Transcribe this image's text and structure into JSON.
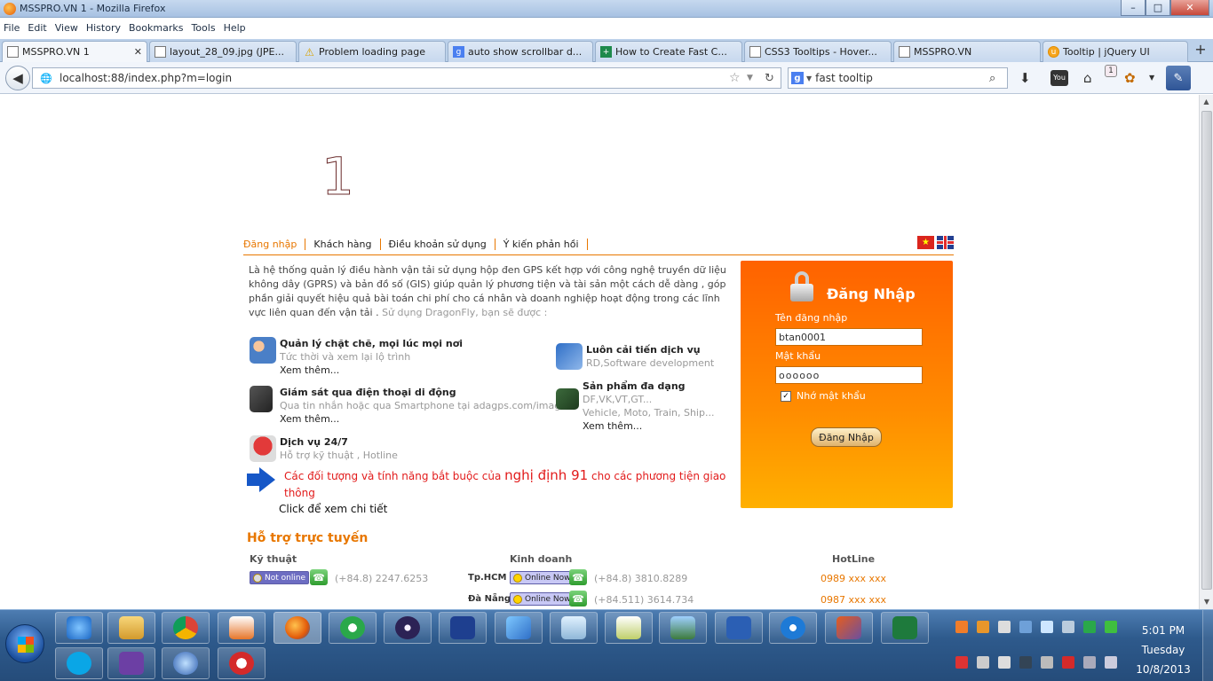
{
  "window": {
    "title": "MSSPRO.VN 1 - Mozilla Firefox",
    "min": "–",
    "max": "□",
    "close": "✕"
  },
  "menubar": [
    "File",
    "Edit",
    "View",
    "History",
    "Bookmarks",
    "Tools",
    "Help"
  ],
  "tabs": [
    {
      "label": "MSSPRO.VN 1"
    },
    {
      "label": "layout_28_09.jpg (JPE..."
    },
    {
      "label": "Problem loading page"
    },
    {
      "label": "auto show scrollbar d..."
    },
    {
      "label": "How to Create Fast C..."
    },
    {
      "label": "CSS3 Tooltips - Hover..."
    },
    {
      "label": "MSSPRO.VN"
    },
    {
      "label": "Tooltip | jQuery UI"
    }
  ],
  "tab_close": "✕",
  "tab_add": "+",
  "nav": {
    "url": "localhost:88/index.php?m=login",
    "search_value": "fast tooltip",
    "search_engine": "g",
    "badge": "1"
  },
  "page": {
    "logo": "1",
    "nav_items": [
      "Đăng nhập",
      "Khách hàng",
      "Điều khoản sử dụng",
      "Ý kiến phản hồi"
    ],
    "flag_star": "★",
    "intro_main": "Là hệ thống quản lý điều hành vận tải sử dụng hộp đen GPS kết hợp với công nghệ truyền dữ liệu không dây (GPRS) và bản đồ số (GIS) giúp quản lý phương tiện và tài sản một cách dễ dàng , góp phần giải quyết hiệu quả bài toán chi phí cho cá nhân và doanh nghiệp hoạt động trong các lĩnh vực liên quan đến vận tải .",
    "intro_gray": "Sử dụng DragonFly, bạn sẽ được :",
    "features": [
      {
        "title": "Quản lý chặt chẽ, mọi lúc mọi nơi",
        "desc1": "Tức thời và xem lại lộ trình",
        "desc2": "",
        "more": "Xem thêm..."
      },
      {
        "title": "Giám sát qua điện thoại di động",
        "desc1": "Qua tin nhắn hoặc qua Smartphone tại adagps.com/images",
        "desc2": "",
        "more": "Xem thêm..."
      },
      {
        "title": "Dịch vụ 24/7",
        "desc1": "Hỗ trợ kỹ thuật , Hotline",
        "desc2": "",
        "more": ""
      },
      {
        "title": "Luôn cải tiến dịch vụ",
        "desc1": "RD,Software development",
        "desc2": "",
        "more": ""
      },
      {
        "title": "Sản phẩm đa dạng",
        "desc1": "DF,VK,VT,GT...",
        "desc2": "Vehicle, Moto, Train, Ship...",
        "more": "Xem thêm..."
      }
    ],
    "decree": {
      "prefix": "Các đối tượng và tính năng bắt buộc của",
      "big": "nghị định 91",
      "suffix": "cho các phương tiện giao thông",
      "link": "Click để xem chi tiết"
    },
    "login": {
      "title": "Đăng Nhập",
      "user_label": "Tên đăng nhập",
      "user_value": "btan0001",
      "pass_label": "Mật khẩu",
      "pass_value": "oooooo",
      "remember": "Nhớ mật khẩu",
      "remember_mark": "✓",
      "button": "Đăng Nhập"
    },
    "support": {
      "title": "Hỗ trợ trực tuyến",
      "headers": [
        "Kỹ thuật",
        "Kinh doanh",
        "HotLine"
      ],
      "tech": {
        "status": "Not online",
        "phone": "(+84.8) 2247.6253"
      },
      "sales": [
        {
          "city": "Tp.HCM",
          "status": "Online Now",
          "phone": "(+84.8) 3810.8289"
        },
        {
          "city": "Đà Nẵng",
          "status": "Online Now",
          "phone": "(+84.511) 3614.734"
        }
      ],
      "hotlines": [
        "0989 xxx xxx",
        "0987 xxx xxx"
      ],
      "phone_glyph": "☎"
    }
  },
  "taskbar": {
    "apps": [
      "Internet Explorer",
      "Windows Explorer",
      "Google Chrome",
      "Media Player",
      "Firefox",
      "Cốc Cốc",
      "Eclipse",
      "Save",
      "Visual Studio",
      "Notepad",
      "Editor",
      "Pictures",
      "Word",
      "TeamViewer",
      "phpDesigner",
      "Excel",
      "Skype",
      "Visual Studio 2",
      "Infinity",
      "Opera"
    ],
    "time": "5:01 PM",
    "day": "Tuesday",
    "date": "10/8/2013"
  }
}
